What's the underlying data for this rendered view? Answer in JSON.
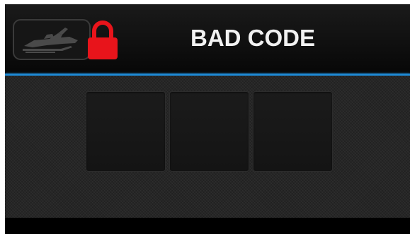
{
  "header": {
    "title": "BAD CODE",
    "vehicle_icon": "snowmobile-icon",
    "lock_icon": "lock-icon",
    "lock_color": "#e8141b",
    "accent_line_color": "#1e8ad6"
  },
  "code_entry": {
    "slots": [
      "",
      "",
      ""
    ]
  }
}
